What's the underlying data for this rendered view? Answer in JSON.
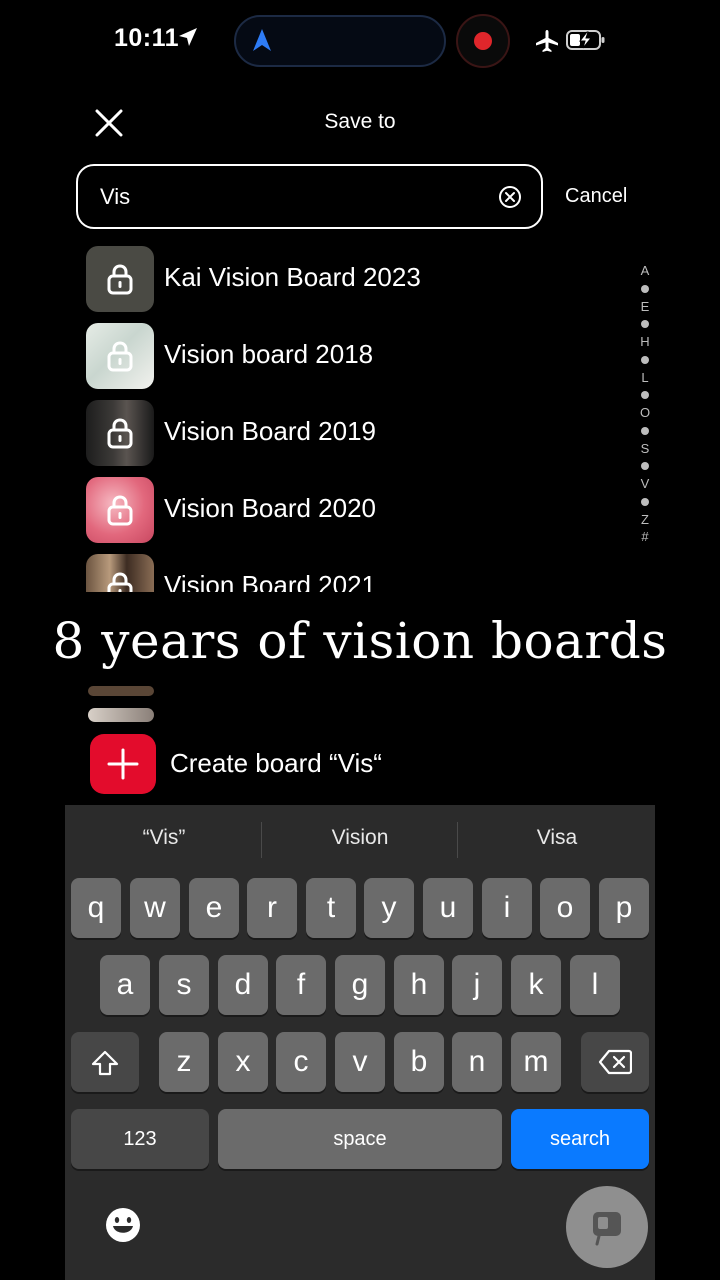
{
  "status": {
    "time": "10:11",
    "icons": [
      "location-arrow-icon",
      "navigation-icon",
      "record-dot-icon",
      "airplane-icon",
      "battery-charging-icon"
    ]
  },
  "header": {
    "title": "Save to",
    "close_icon": "close-icon"
  },
  "search": {
    "value": "Vis",
    "cancel_label": "Cancel"
  },
  "boards": [
    {
      "name": "Kai Vision Board 2023",
      "locked": true
    },
    {
      "name": "Vision board 2018",
      "locked": true
    },
    {
      "name": "Vision Board 2019",
      "locked": true
    },
    {
      "name": "Vision Board 2020",
      "locked": true
    },
    {
      "name": "Vision Board 2021",
      "locked": true
    }
  ],
  "index_letters": [
    "A",
    "E",
    "H",
    "L",
    "O",
    "S",
    "V",
    "Z",
    "#"
  ],
  "caption": "8 years of vision boards",
  "create": {
    "label": "Create board “Vis“"
  },
  "keyboard": {
    "suggestions": [
      "“Vis”",
      "Vision",
      "Visa"
    ],
    "row1": [
      "q",
      "w",
      "e",
      "r",
      "t",
      "y",
      "u",
      "i",
      "o",
      "p"
    ],
    "row2": [
      "a",
      "s",
      "d",
      "f",
      "g",
      "h",
      "j",
      "k",
      "l"
    ],
    "row3": [
      "z",
      "x",
      "c",
      "v",
      "b",
      "n",
      "m"
    ],
    "numbers_label": "123",
    "space_label": "space",
    "search_label": "search"
  },
  "colors": {
    "accent_red": "#e30c2c",
    "search_blue": "#0a7aff"
  }
}
